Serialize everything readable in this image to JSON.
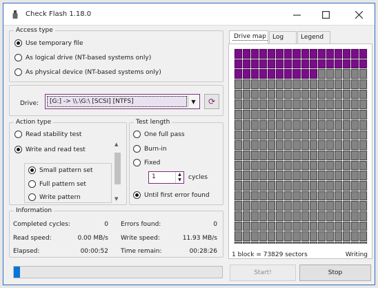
{
  "window": {
    "title": "Check Flash 1.18.0"
  },
  "access_type": {
    "legend": "Access type",
    "options": [
      {
        "label": "Use temporary file",
        "selected": true
      },
      {
        "label": "As logical drive (NT-based systems only)",
        "selected": false
      },
      {
        "label": "As physical device (NT-based systems only)",
        "selected": false
      }
    ]
  },
  "drive": {
    "label": "Drive:",
    "value": "[G:] -> \\\\.\\G:\\ [SCSI] [NTFS]"
  },
  "action_type": {
    "legend": "Action type",
    "options": [
      {
        "label": "Read stability test",
        "selected": false
      },
      {
        "label": "Write and read test",
        "selected": true
      }
    ],
    "patterns": [
      {
        "label": "Small pattern set",
        "selected": true
      },
      {
        "label": "Full pattern set",
        "selected": false
      },
      {
        "label": "Write pattern",
        "selected": false
      }
    ]
  },
  "test_length": {
    "legend": "Test length",
    "options": [
      {
        "label": "One full pass",
        "selected": false
      },
      {
        "label": "Burn-in",
        "selected": false
      },
      {
        "label": "Fixed",
        "selected": false
      },
      {
        "label": "Until first error found",
        "selected": true
      }
    ],
    "cycles_value": "1",
    "cycles_label": "cycles"
  },
  "information": {
    "legend": "Information",
    "rows": [
      {
        "left_label": "Completed cycles:",
        "left_value": "0",
        "right_label": "Errors found:",
        "right_value": "0"
      },
      {
        "left_label": "Read speed:",
        "left_value": "0.00 MB/s",
        "right_label": "Write speed:",
        "right_value": "11.93 MB/s"
      },
      {
        "left_label": "Elapsed:",
        "left_value": "00:00:52",
        "right_label": "Time remain:",
        "right_value": "00:28:26"
      }
    ]
  },
  "progress": {
    "fraction": 0.03
  },
  "tabs": [
    {
      "label": "Drive map",
      "active": true
    },
    {
      "label": "Log",
      "active": false
    },
    {
      "label": "Legend",
      "active": false
    }
  ],
  "map": {
    "columns": 16,
    "rows": 20,
    "done_blocks": 42
  },
  "status": {
    "left": "1 block = 73829 sectors",
    "right": "Writing"
  },
  "buttons": {
    "start": "Start!",
    "stop": "Stop"
  },
  "colors": {
    "done": "#7b0d8a",
    "pending": "#848484",
    "progress": "#0a74d8"
  }
}
